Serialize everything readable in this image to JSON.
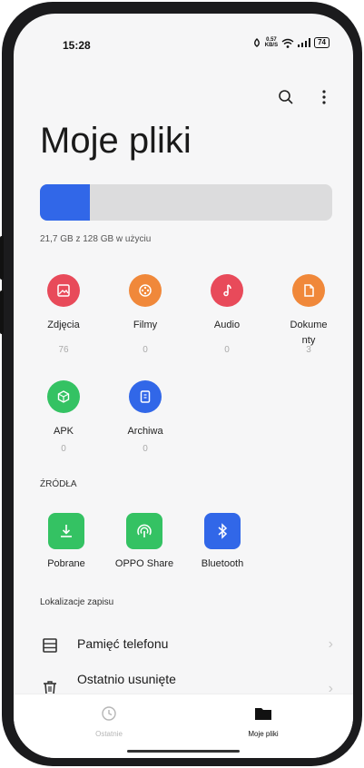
{
  "status_bar": {
    "time": "15:28",
    "speed_value": "0.57",
    "speed_unit": "KB/S",
    "battery": "74"
  },
  "page_title": "Moje pliki",
  "storage": {
    "used_fraction": 0.17,
    "text": "21,7 GB z 128 GB w użyciu"
  },
  "categories": [
    {
      "label": "Zdjęcia",
      "count": "76",
      "color": "#e84a5a",
      "icon": "image-icon"
    },
    {
      "label": "Filmy",
      "count": "0",
      "color": "#f0883a",
      "icon": "film-reel-icon"
    },
    {
      "label": "Audio",
      "count": "0",
      "color": "#e84a5a",
      "icon": "music-note-icon"
    },
    {
      "label": "Dokumenty",
      "label_line1": "Dokume",
      "label_line2": "nty",
      "count": "3",
      "color": "#f0883a",
      "icon": "document-icon"
    },
    {
      "label": "APK",
      "count": "0",
      "color": "#34c263",
      "icon": "package-icon"
    },
    {
      "label": "Archiwa",
      "count": "0",
      "color": "#3167e8",
      "icon": "archive-icon"
    }
  ],
  "sources_heading": "ŹRÓDŁA",
  "sources": [
    {
      "label": "Pobrane",
      "color": "#34c263",
      "icon": "download-icon"
    },
    {
      "label": "OPPO Share",
      "color": "#34c263",
      "icon": "oppo-share-icon"
    },
    {
      "label": "Bluetooth",
      "color": "#3167e8",
      "icon": "bluetooth-icon"
    }
  ],
  "locations_heading": "Lokalizacje zapisu",
  "locations": [
    {
      "label": "Pamięć telefonu",
      "icon": "storage-icon"
    },
    {
      "label": "Ostatnio usunięte",
      "icon": "trash-icon"
    }
  ],
  "nav": [
    {
      "label": "Ostatnie",
      "icon": "clock-icon",
      "active": false
    },
    {
      "label": "Moje pliki",
      "icon": "folder-icon",
      "active": true
    }
  ]
}
